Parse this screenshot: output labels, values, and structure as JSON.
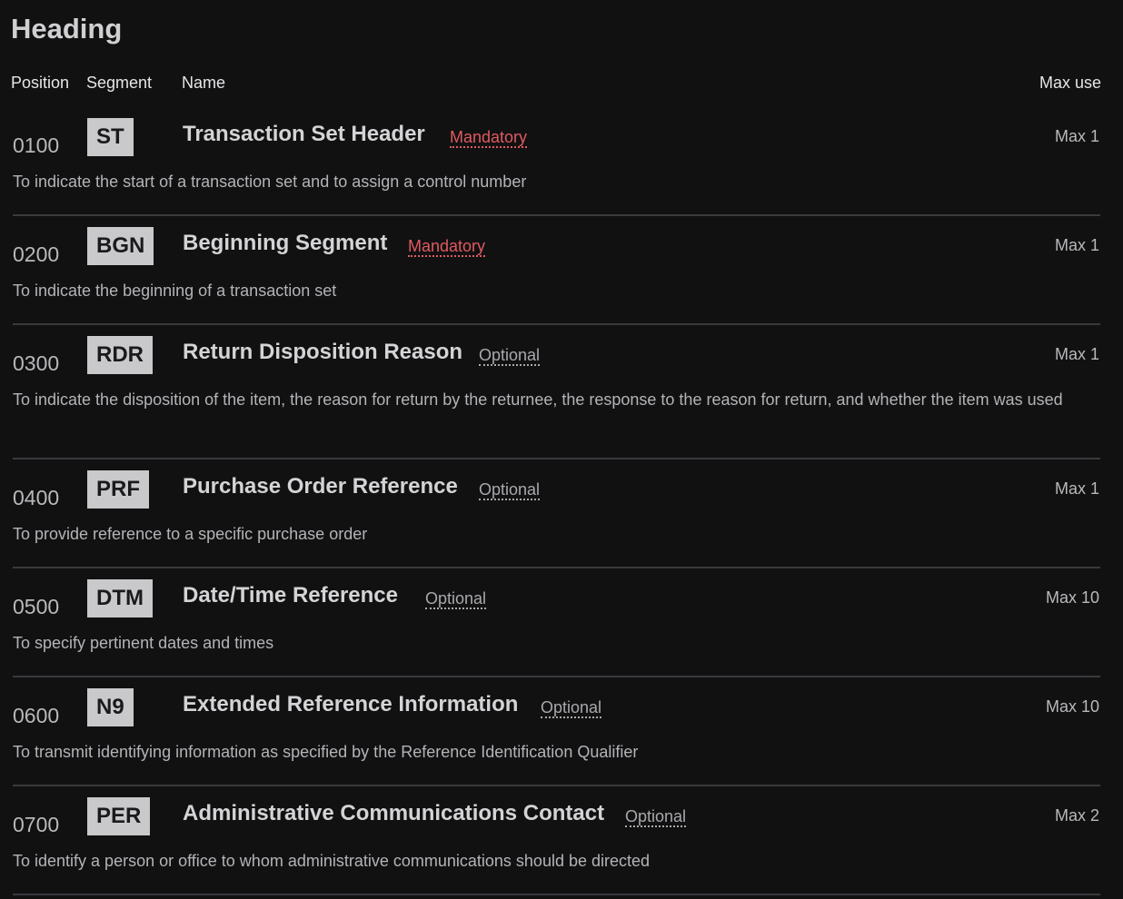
{
  "section": {
    "title": "Heading"
  },
  "columns": {
    "position": "Position",
    "segment": "Segment",
    "name": "Name",
    "max_use": "Max use"
  },
  "rows": [
    {
      "position": "0100",
      "code": "ST",
      "name": "Transaction Set Header",
      "requirement": "Mandatory",
      "max": "Max 1",
      "description": "To indicate the start of a transaction set and to assign a control number"
    },
    {
      "position": "0200",
      "code": "BGN",
      "name": "Beginning Segment",
      "requirement": "Mandatory",
      "max": "Max 1",
      "description": "To indicate the beginning of a transaction set"
    },
    {
      "position": "0300",
      "code": "RDR",
      "name": "Return Disposition Reason",
      "requirement": "Optional",
      "max": "Max 1",
      "description": "To indicate the disposition of the item, the reason for return by the returnee, the response to the reason for return, and whether the item was used"
    },
    {
      "position": "0400",
      "code": "PRF",
      "name": "Purchase Order Reference",
      "requirement": "Optional",
      "max": "Max 1",
      "description": "To provide reference to a specific purchase order"
    },
    {
      "position": "0500",
      "code": "DTM",
      "name": "Date/Time Reference",
      "requirement": "Optional",
      "max": "Max 10",
      "description": "To specify pertinent dates and times"
    },
    {
      "position": "0600",
      "code": "N9",
      "name": "Extended Reference Information",
      "requirement": "Optional",
      "max": "Max 10",
      "description": "To transmit identifying information as specified by the Reference Identification Qualifier"
    },
    {
      "position": "0700",
      "code": "PER",
      "name": "Administrative Communications Contact",
      "requirement": "Optional",
      "max": "Max 2",
      "description": "To identify a person or office to whom administrative communications should be directed"
    }
  ],
  "colors": {
    "background": "#111112",
    "mandatory": "#e05a5f",
    "optional": "#a9a9ad",
    "badge": "#c9c9cc",
    "divider": "#3a3a3d"
  }
}
